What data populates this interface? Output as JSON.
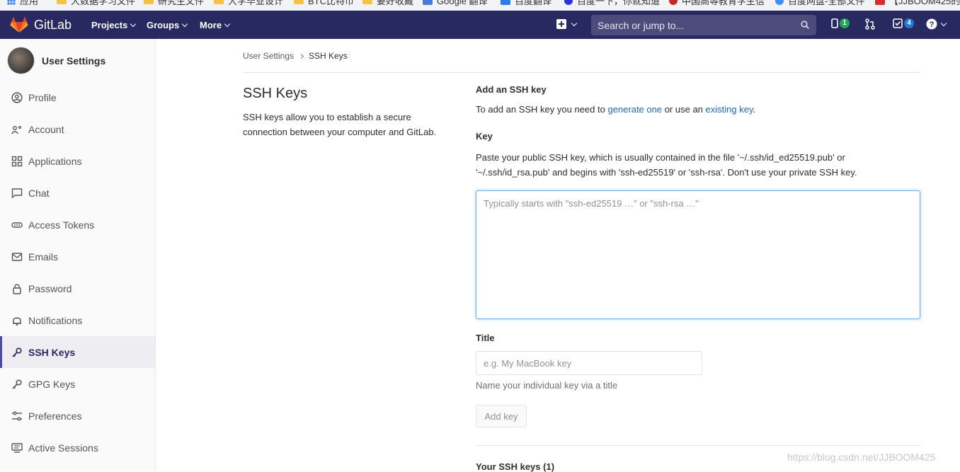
{
  "bookmarks": [
    {
      "label": "应用",
      "icon": "apps-icon"
    },
    {
      "label": "大数据学习文件",
      "icon": "folder-icon"
    },
    {
      "label": "研究生文件",
      "icon": "folder-icon"
    },
    {
      "label": "大学毕业设计",
      "icon": "folder-icon"
    },
    {
      "label": "BTC比特币",
      "icon": "folder-icon"
    },
    {
      "label": "要好收藏",
      "icon": "folder-icon"
    },
    {
      "label": "Google 翻译",
      "icon": "google-translate-icon"
    },
    {
      "label": "百度翻译",
      "icon": "baidu-translate-icon"
    },
    {
      "label": "百度一下，你就知道",
      "icon": "baidu-icon"
    },
    {
      "label": "中国高等教育学生信",
      "icon": "chsi-icon"
    },
    {
      "label": "百度网盘-全部文件",
      "icon": "baidu-pan-icon"
    },
    {
      "label": "【JJBOOM425的",
      "icon": "csdn-icon"
    }
  ],
  "navbar": {
    "brand": "GitLab",
    "projects": "Projects",
    "groups": "Groups",
    "more": "More",
    "search_placeholder": "Search or jump to...",
    "issues_count": "1",
    "todos_count": "4",
    "accent": "#292961"
  },
  "sidebar": {
    "title": "User Settings",
    "items": [
      {
        "label": "Profile",
        "icon": "profile-icon"
      },
      {
        "label": "Account",
        "icon": "account-icon"
      },
      {
        "label": "Applications",
        "icon": "applications-icon"
      },
      {
        "label": "Chat",
        "icon": "chat-icon"
      },
      {
        "label": "Access Tokens",
        "icon": "access-tokens-icon"
      },
      {
        "label": "Emails",
        "icon": "emails-icon"
      },
      {
        "label": "Password",
        "icon": "lock-icon"
      },
      {
        "label": "Notifications",
        "icon": "bell-icon"
      },
      {
        "label": "SSH Keys",
        "icon": "key-icon",
        "active": true
      },
      {
        "label": "GPG Keys",
        "icon": "key-icon"
      },
      {
        "label": "Preferences",
        "icon": "sliders-icon"
      },
      {
        "label": "Active Sessions",
        "icon": "monitor-icon"
      }
    ]
  },
  "breadcrumb": {
    "parent": "User Settings",
    "current": "SSH Keys"
  },
  "intro": {
    "title": "SSH Keys",
    "description": "SSH keys allow you to establish a secure connection between your computer and GitLab."
  },
  "form": {
    "heading": "Add an SSH key",
    "desc_prefix": "To add an SSH key you need to ",
    "generate_link": "generate one",
    "desc_middle": " or use an ",
    "existing_link": "existing key",
    "desc_suffix": ".",
    "key_label": "Key",
    "key_help": "Paste your public SSH key, which is usually contained in the file '~/.ssh/id_ed25519.pub' or '~/.ssh/id_rsa.pub' and begins with 'ssh-ed25519' or 'ssh-rsa'. Don't use your private SSH key.",
    "key_placeholder": "Typically starts with \"ssh-ed25519 …\" or \"ssh-rsa …\"",
    "title_label": "Title",
    "title_placeholder": "e.g. My MacBook key",
    "title_help": "Name your individual key via a title",
    "add_button": "Add key"
  },
  "your_keys_heading": "Your SSH keys (1)",
  "watermark": "https://blog.csdn.net/JJBOOM425"
}
